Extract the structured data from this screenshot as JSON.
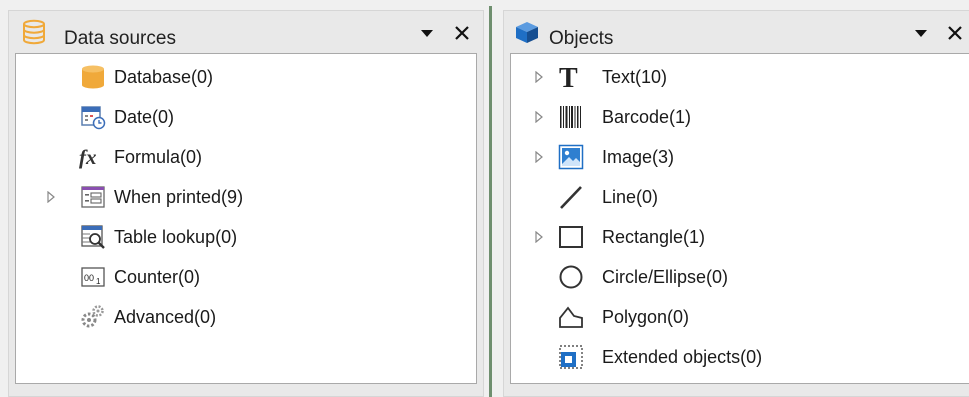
{
  "data_sources": {
    "title": "Data sources",
    "header_icon": "database-stack-icon",
    "items": [
      {
        "label": "Database(0)",
        "icon": "database-icon",
        "expandable": false
      },
      {
        "label": "Date(0)",
        "icon": "calendar-clock-icon",
        "expandable": false
      },
      {
        "label": "Formula(0)",
        "icon": "formula-fx-icon",
        "expandable": false
      },
      {
        "label": "When printed(9)",
        "icon": "form-icon",
        "expandable": true
      },
      {
        "label": "Table lookup(0)",
        "icon": "table-lookup-icon",
        "expandable": false
      },
      {
        "label": "Counter(0)",
        "icon": "counter-icon",
        "expandable": false
      },
      {
        "label": "Advanced(0)",
        "icon": "gears-icon",
        "expandable": false
      }
    ]
  },
  "objects": {
    "title": "Objects",
    "header_icon": "cube-icon",
    "items": [
      {
        "label": "Text(10)",
        "icon": "text-t-icon",
        "expandable": true
      },
      {
        "label": "Barcode(1)",
        "icon": "barcode-icon",
        "expandable": true
      },
      {
        "label": "Image(3)",
        "icon": "image-icon",
        "expandable": true
      },
      {
        "label": "Line(0)",
        "icon": "line-icon",
        "expandable": false
      },
      {
        "label": "Rectangle(1)",
        "icon": "rectangle-icon",
        "expandable": true
      },
      {
        "label": "Circle/Ellipse(0)",
        "icon": "circle-icon",
        "expandable": false
      },
      {
        "label": "Polygon(0)",
        "icon": "polygon-icon",
        "expandable": false
      },
      {
        "label": "Extended objects(0)",
        "icon": "extended-objects-icon",
        "expandable": false
      }
    ]
  },
  "colors": {
    "accent_blue": "#1f6fc5",
    "db_orange": "#f0a93a",
    "form_purple": "#8a4fb0",
    "splitter_green": "#6f8f6f"
  }
}
